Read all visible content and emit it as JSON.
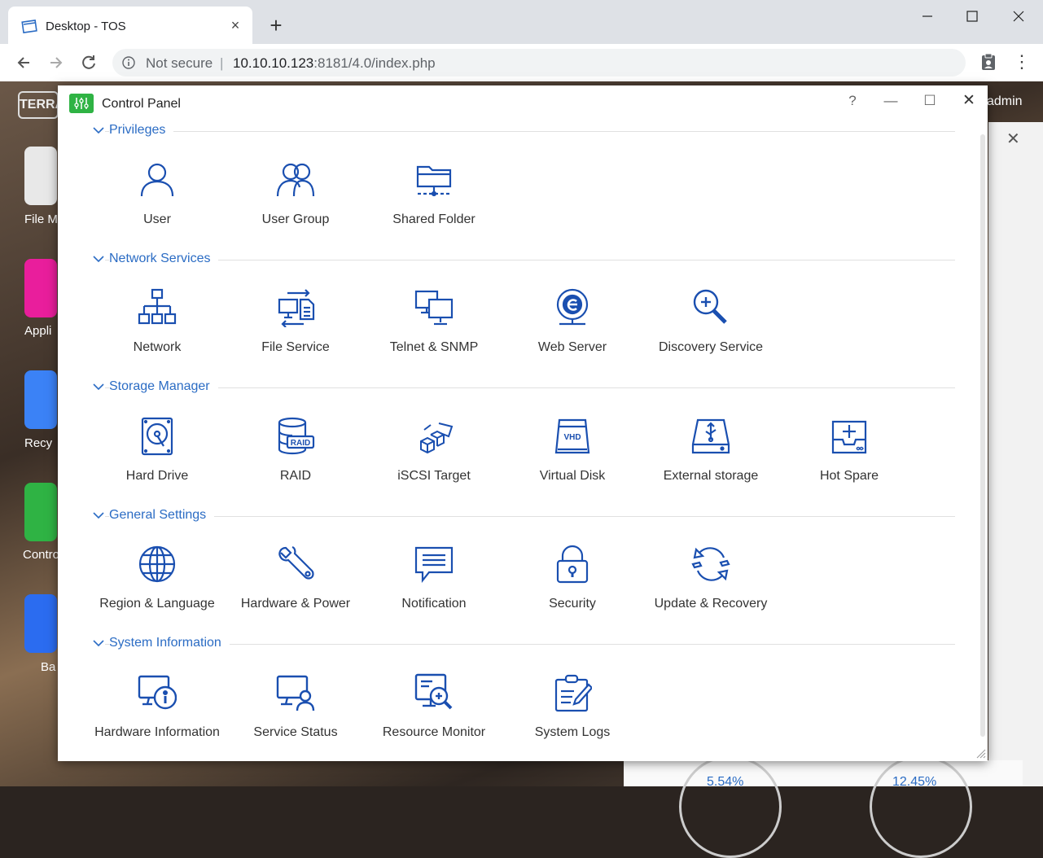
{
  "browser": {
    "tab_title": "Desktop - TOS",
    "tab_close": "×",
    "new_tab": "+",
    "security_label": "Not secure",
    "separator": "|",
    "url_host": "10.10.10.123",
    "url_rest": ":8181/4.0/index.php",
    "menu": "⋮"
  },
  "desktop": {
    "logo": "TERRA",
    "user": "admin",
    "icons": [
      {
        "label": "File M",
        "color": "#f39c12"
      },
      {
        "label": "Appli",
        "color": "#e91e9c"
      },
      {
        "label": "Recy",
        "color": "#3b82f6"
      },
      {
        "label": "Contro",
        "color": "#2fb344"
      },
      {
        "label": "Ba",
        "color": "#2b6cf0"
      }
    ],
    "gauges": [
      "5.54%",
      "12.45%"
    ]
  },
  "control_panel": {
    "title": "Control Panel",
    "help": "?",
    "minimize": "—",
    "maximize": "☐",
    "close": "✕",
    "accent_color": "#2b6cc4",
    "icon_color": "#1a4fb0",
    "sections": [
      {
        "title": "Privileges",
        "items": [
          {
            "label": "User",
            "icon": "user-icon"
          },
          {
            "label": "User Group",
            "icon": "user-group-icon"
          },
          {
            "label": "Shared Folder",
            "icon": "shared-folder-icon"
          }
        ]
      },
      {
        "title": "Network Services",
        "items": [
          {
            "label": "Network",
            "icon": "network-icon"
          },
          {
            "label": "File Service",
            "icon": "file-service-icon"
          },
          {
            "label": "Telnet & SNMP",
            "icon": "telnet-snmp-icon"
          },
          {
            "label": "Web Server",
            "icon": "web-server-icon"
          },
          {
            "label": "Discovery Service",
            "icon": "discovery-service-icon"
          }
        ]
      },
      {
        "title": "Storage Manager",
        "items": [
          {
            "label": "Hard Drive",
            "icon": "hard-drive-icon"
          },
          {
            "label": "RAID",
            "icon": "raid-icon"
          },
          {
            "label": "iSCSI Target",
            "icon": "iscsi-target-icon"
          },
          {
            "label": "Virtual Disk",
            "icon": "virtual-disk-icon"
          },
          {
            "label": "External storage",
            "icon": "external-storage-icon"
          },
          {
            "label": "Hot Spare",
            "icon": "hot-spare-icon"
          }
        ]
      },
      {
        "title": "General Settings",
        "items": [
          {
            "label": "Region & Language",
            "icon": "globe-icon"
          },
          {
            "label": "Hardware & Power",
            "icon": "wrench-icon"
          },
          {
            "label": "Notification",
            "icon": "notification-icon"
          },
          {
            "label": "Security",
            "icon": "lock-icon"
          },
          {
            "label": "Update & Recovery",
            "icon": "update-icon"
          }
        ]
      },
      {
        "title": "System Information",
        "items": [
          {
            "label": "Hardware Information",
            "icon": "hardware-info-icon"
          },
          {
            "label": "Service Status",
            "icon": "service-status-icon"
          },
          {
            "label": "Resource Monitor",
            "icon": "resource-monitor-icon"
          },
          {
            "label": "System Logs",
            "icon": "system-logs-icon"
          }
        ]
      }
    ],
    "raid_badge": "RAID",
    "vhd_badge": "VHD"
  }
}
